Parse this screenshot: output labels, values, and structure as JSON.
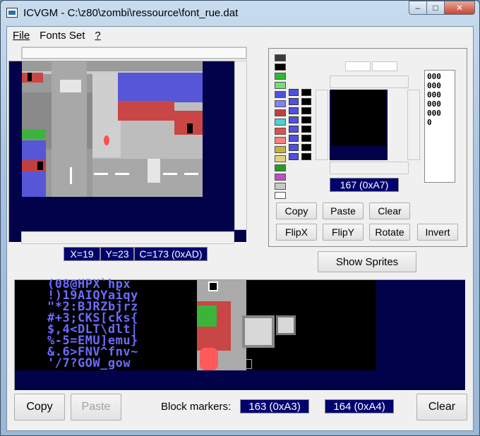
{
  "window": {
    "title": "ICVGM - C:\\z80\\zombi\\ressource\\font_rue.dat",
    "minimize_glyph": "–",
    "maximize_glyph": "□",
    "close_glyph": "✕"
  },
  "menu": {
    "items": [
      "File",
      "Fonts Set",
      "?"
    ]
  },
  "status": {
    "x": "X=19",
    "y": "Y=23",
    "c": "C=173 (0xAD)"
  },
  "editor": {
    "hex_lines": [
      "000",
      "000",
      "000",
      "000",
      "000",
      "0"
    ],
    "char_label": "167 (0xA7)",
    "buttons": {
      "copy": "Copy",
      "paste": "Paste",
      "clear": "Clear",
      "flipx": "FlipX",
      "flipy": "FlipY",
      "rotate": "Rotate",
      "invert": "Invert"
    },
    "palette_colors": [
      "#3a3a3a",
      "#000000",
      "#2fb82f",
      "#77dd77",
      "#5050e0",
      "#8080ff",
      "#c04040",
      "#50d0d0",
      "#e05050",
      "#ff8080",
      "#c8b040",
      "#e0d080",
      "#20a020",
      "#c050c0",
      "#c8c8c8",
      "#ffffff"
    ]
  },
  "show_sprites_label": "Show Sprites",
  "font_rows": [
    "(08@HPX`hpx",
    "!)19AIQYaiqy",
    "\"*2:BJRZbjrz",
    "#+3;CKS[cks{",
    "$,4<DLT\\dlt|",
    "%-5=EMU]emu}",
    "&.6>FNV^fnv~",
    "'/7?GOW_gow"
  ],
  "bottom": {
    "copy": "Copy",
    "paste": "Paste",
    "block_markers_label": "Block markers:",
    "marker1": "163 (0xA3)",
    "marker2": "164 (0xA4)",
    "clear": "Clear"
  },
  "colors": {
    "field_bg": "#02026e",
    "canvas_bg": "#02024a",
    "glyph_color": "#6b6bff"
  }
}
